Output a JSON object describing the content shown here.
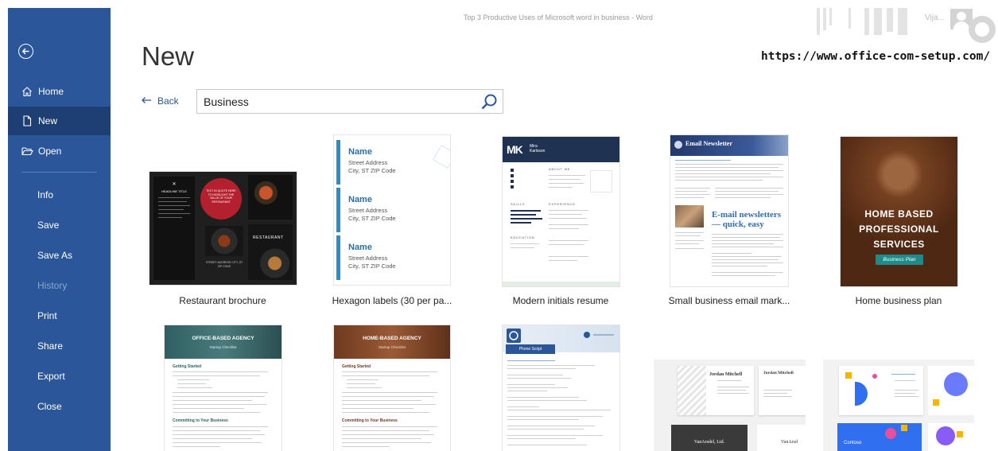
{
  "window": {
    "title": "Top 3 Productive Uses of Microsoft word in business  -  Word",
    "user": "Vija..."
  },
  "watermark": "https://www.office-com-setup.com/",
  "page": {
    "title": "New"
  },
  "sidebar": {
    "items": [
      {
        "label": "Home",
        "icon": "home-icon"
      },
      {
        "label": "New",
        "icon": "new-document-icon",
        "selected": true
      },
      {
        "label": "Open",
        "icon": "folder-open-icon"
      },
      {
        "label": "Info"
      },
      {
        "label": "Save"
      },
      {
        "label": "Save As"
      },
      {
        "label": "History",
        "disabled": true
      },
      {
        "label": "Print"
      },
      {
        "label": "Share"
      },
      {
        "label": "Export"
      },
      {
        "label": "Close"
      }
    ]
  },
  "toolbar": {
    "back_label": "Back"
  },
  "search": {
    "value": "Business",
    "icon": "search-icon"
  },
  "colors": {
    "accent": "#2b579a",
    "accent_dark": "#1e3f73"
  },
  "templates": [
    {
      "label": "Restaurant brochure",
      "thumb": {
        "heading": "HEADLINE TITLE",
        "circle_text": "TEXT IN QUOTE HERE TO HIGHLIGHT THE VALUE OF YOUR RESTAURANT",
        "badge": "RESTAURANT",
        "address": "STREET ADDRESS CITY, ST ZIP CODE"
      }
    },
    {
      "label": "Hexagon labels (30 per pa...",
      "thumb": {
        "name": "Name",
        "line1": "Street Address",
        "line2": "City, ST ZIP Code"
      }
    },
    {
      "label": "Modern initials resume",
      "thumb": {
        "initials": "MK",
        "name": "Mira Karlsson",
        "about": "ABOUT ME",
        "skills": "SKILLS",
        "experience": "EXPERIENCE",
        "education": "EDUCATION"
      }
    },
    {
      "label": "Small business email mark...",
      "thumb": {
        "title": "Email Newsletter",
        "headline": "E-mail newsletters — quick, easy"
      }
    },
    {
      "label": "Home business plan",
      "thumb": {
        "line1": "HOME BASED",
        "line2": "PROFESSIONAL",
        "line3": "SERVICES",
        "button": "Business Plan"
      }
    },
    {
      "thumb": {
        "title": "OFFICE-BASED AGENCY",
        "subtitle": "Startup Checklist",
        "section1": "Getting Started",
        "section2": "Committing to Your Business"
      }
    },
    {
      "thumb": {
        "title": "HOME-BASED AGENCY",
        "subtitle": "Startup Checklist",
        "section1": "Getting Started",
        "section2": "Committing to Your Business"
      }
    },
    {
      "thumb": {
        "heading": "Phone Script"
      }
    },
    {
      "thumb": {
        "name": "Jordan Mitchell",
        "company": "VanArsdel, Ltd.",
        "company_short": "VanArsd"
      }
    },
    {
      "thumb": {
        "company": "Contoso"
      }
    }
  ]
}
